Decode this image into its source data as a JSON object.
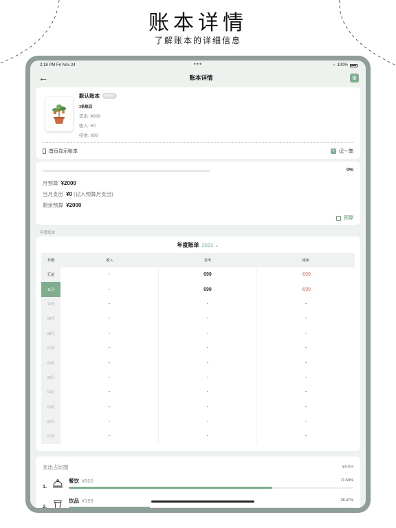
{
  "promo": {
    "title": "账本详情",
    "subtitle": "了解账本的详细信息"
  },
  "status": {
    "time": "2:18 PM",
    "date": "Fri Nov 24",
    "dots": "•••",
    "battery": "100%"
  },
  "nav": {
    "title": "账本详情"
  },
  "book": {
    "name": "默认账本",
    "badge": "使用中",
    "count": "3条账目",
    "expense": "支出: ¥699",
    "income": "收入: ¥0",
    "balance": "结余: 699",
    "home_toggle": "首页显示账本",
    "record_label": "记一笔"
  },
  "budget": {
    "percent_text": "0%",
    "progress": 0,
    "monthly_label": "月预算",
    "monthly_value": "¥2000",
    "spent_label": "当月支出",
    "spent_value": "¥0",
    "spent_note": "(记入预算月支出)",
    "remaining_label": "剩余预算",
    "remaining_value": "¥2000",
    "button_label": "预算"
  },
  "annual": {
    "section_label": "年度账单",
    "title": "年度账单",
    "year": "2023",
    "headers": [
      "日期",
      "收入",
      "支出",
      "结余"
    ],
    "rows": [
      {
        "date": "汇总",
        "income": "-",
        "expense": "699",
        "balance": "-699"
      },
      {
        "date": "11月",
        "income": "-",
        "expense": "699",
        "balance": "-699"
      },
      {
        "date": "10月",
        "income": "-",
        "expense": "-",
        "balance": "-"
      },
      {
        "date": "09月",
        "income": "-",
        "expense": "-",
        "balance": "-"
      },
      {
        "date": "08月",
        "income": "-",
        "expense": "-",
        "balance": "-"
      },
      {
        "date": "07月",
        "income": "-",
        "expense": "-",
        "balance": "-"
      },
      {
        "date": "06月",
        "income": "-",
        "expense": "-",
        "balance": "-"
      },
      {
        "date": "05月",
        "income": "-",
        "expense": "-",
        "balance": "-"
      },
      {
        "date": "04月",
        "income": "-",
        "expense": "-",
        "balance": "-"
      },
      {
        "date": "03月",
        "income": "-",
        "expense": "-",
        "balance": "-"
      },
      {
        "date": "02月",
        "income": "-",
        "expense": "-",
        "balance": "-"
      },
      {
        "date": "01月",
        "income": "-",
        "expense": "-",
        "balance": "-"
      }
    ]
  },
  "ratio": {
    "title": "支出占比图",
    "total": "¥699",
    "categories": [
      {
        "rank": "1.",
        "name": "餐饮",
        "amount": "¥500",
        "percent": "71.53%",
        "fraction": 0.7153,
        "icon": "cloche-icon"
      },
      {
        "rank": "2.",
        "name": "饮品",
        "amount": "¥199",
        "percent": "28.47%",
        "fraction": 0.2847,
        "icon": "drink-icon"
      }
    ]
  },
  "colors": {
    "accent": "#7fae8e",
    "negative": "#e06b6b",
    "frame": "#8f9e9b",
    "background": "#edf2ef"
  }
}
